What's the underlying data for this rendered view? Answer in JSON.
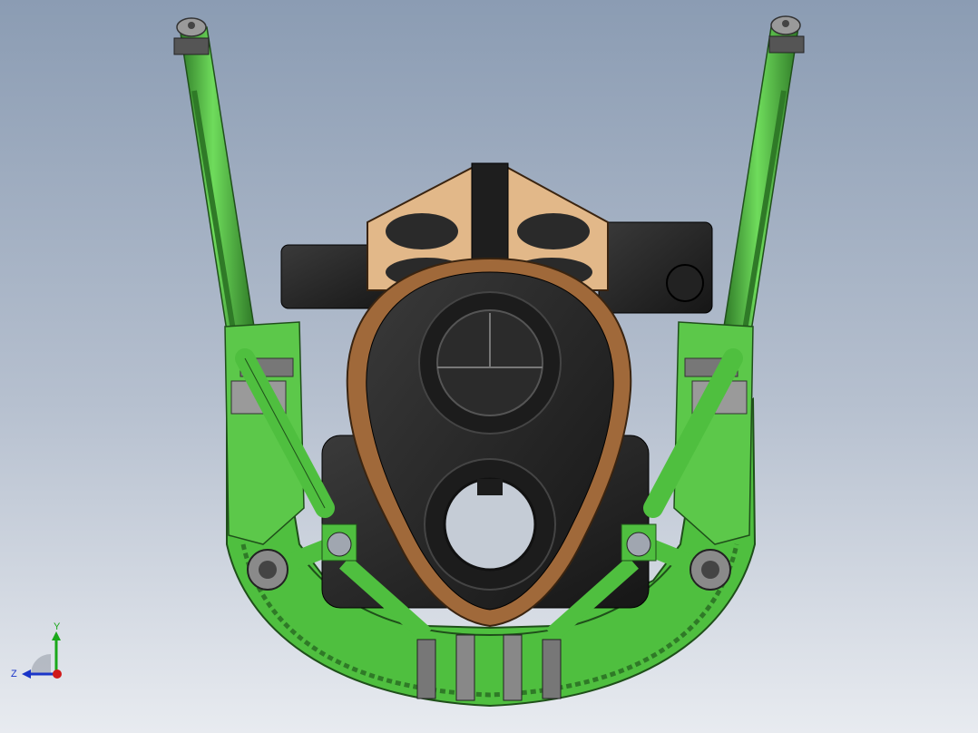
{
  "viewport": {
    "background_top": "#8b9cb3",
    "background_bottom": "#e8ebf0"
  },
  "model": {
    "frame_color": "#4fbf3f",
    "frame_dark": "#2f7a27",
    "engine_color": "#2a2a2a",
    "gasket_color": "#a0693a",
    "bracket_color": "#e2b889"
  },
  "triad": {
    "y_label": "Y",
    "z_label": "Z",
    "y_color": "#1aa81a",
    "z_color": "#1a35c8",
    "x_color": "#d01a1a"
  }
}
